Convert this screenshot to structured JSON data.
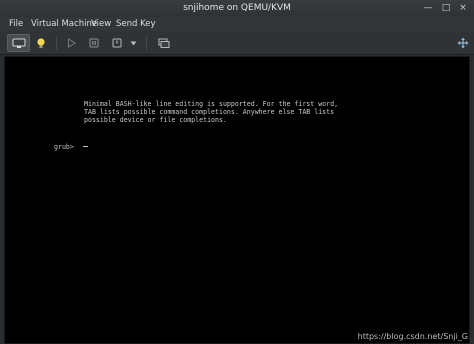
{
  "window": {
    "title": "snjihome on QEMU/KVM",
    "controls": {
      "minimize": "—",
      "maximize": "□",
      "close": "×"
    }
  },
  "menu": [
    "File",
    "Virtual Machine",
    "View",
    "Send Key"
  ],
  "toolbar": {
    "buttons": [
      {
        "name": "console-view",
        "icon": "monitor-icon",
        "active": true
      },
      {
        "name": "details-view",
        "icon": "lightbulb-icon",
        "active": false
      },
      {
        "name": "run",
        "icon": "play-icon",
        "active": false
      },
      {
        "name": "pause",
        "icon": "pause-icon",
        "active": false
      },
      {
        "name": "shutdown",
        "icon": "power-icon",
        "active": false
      },
      {
        "name": "shutdown-menu",
        "icon": "chevron-down-icon",
        "active": false
      },
      {
        "name": "snapshots",
        "icon": "snapshot-icon",
        "active": false
      },
      {
        "name": "fullscreen",
        "icon": "resize-icon",
        "active": false
      }
    ]
  },
  "console": {
    "lines": [
      "Minimal BASH-like line editing is supported. For the first word,",
      "TAB lists possible command completions. Anywhere else TAB lists",
      "possible device or file completions."
    ],
    "prompt": "grub>"
  },
  "watermark": "https://blog.csdn.net/Snji_G"
}
